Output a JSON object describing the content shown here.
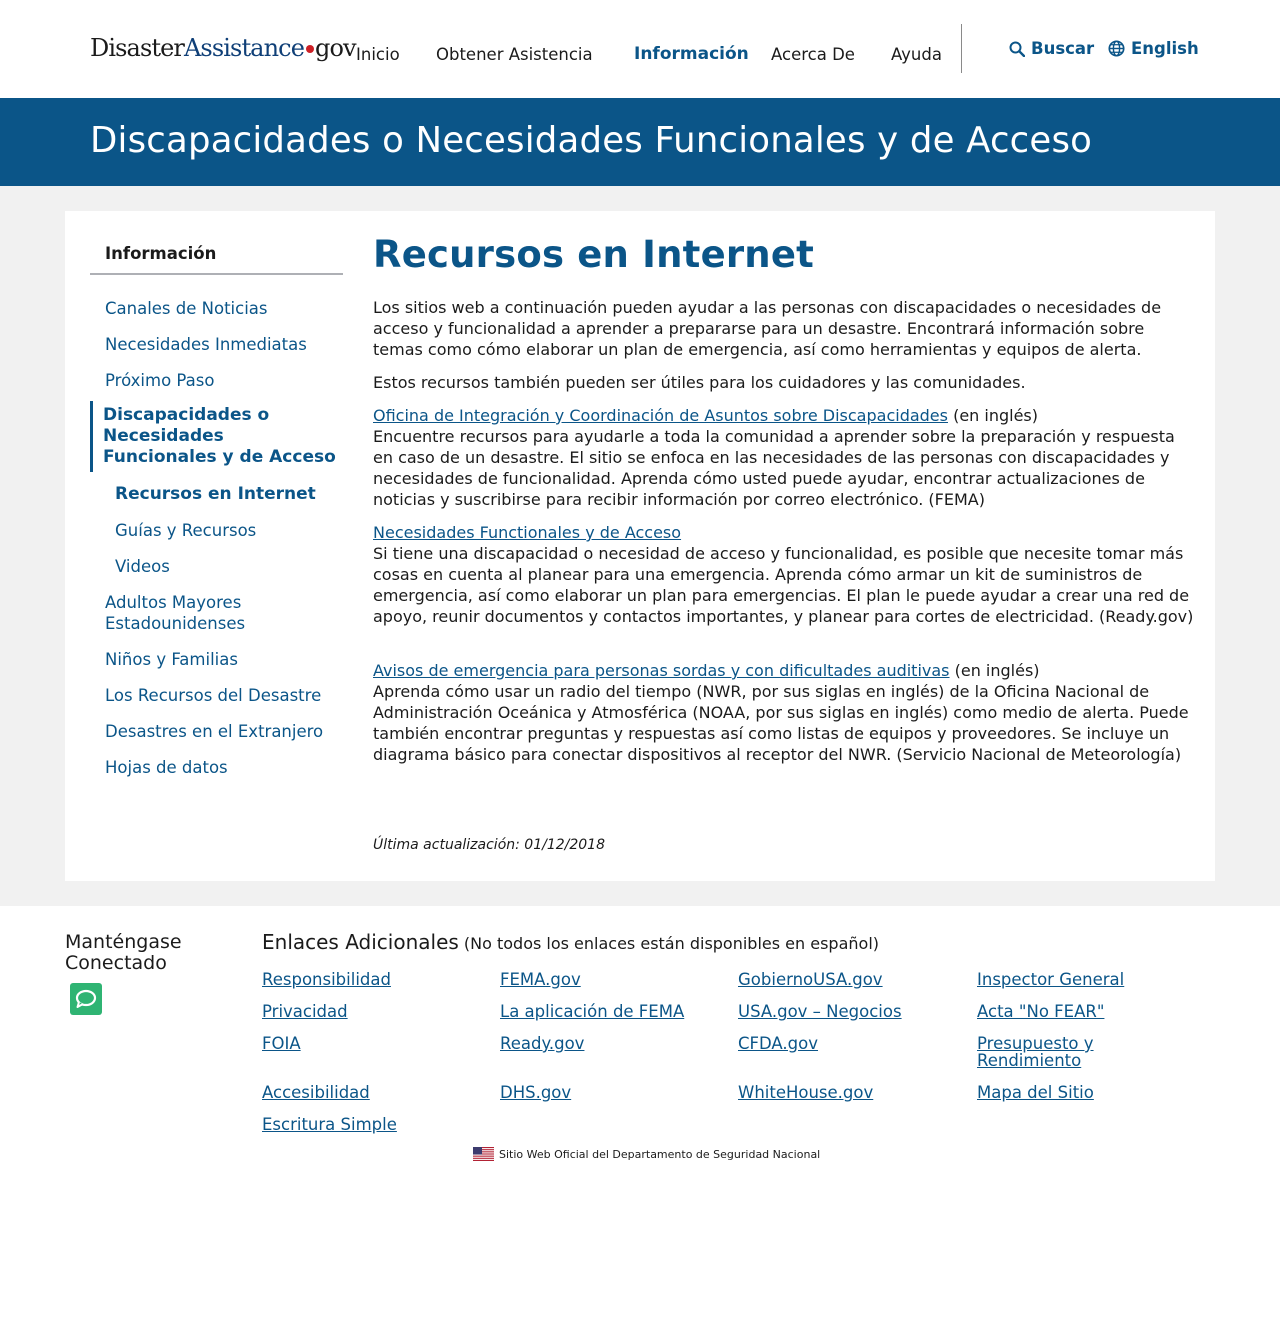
{
  "logo": {
    "part1": "Disaster",
    "part2": "Assistance",
    "part3": "gov"
  },
  "nav": {
    "items": [
      {
        "label": "Inicio"
      },
      {
        "label": "Obtener Asistencia"
      },
      {
        "label": "Información"
      },
      {
        "label": "Acerca De"
      },
      {
        "label": "Ayuda"
      }
    ],
    "search_label": "Buscar",
    "language_label": "English"
  },
  "hero": {
    "title": "Discapacidades o Necesidades Funcionales y de Acceso"
  },
  "sidebar": {
    "heading": "Información",
    "items": [
      {
        "label": "Canales de Noticias"
      },
      {
        "label": "Necesidades Inmediatas"
      },
      {
        "label": "Próximo Paso"
      },
      {
        "label": "Discapacidades o Necesidades Funcionales y de Acceso"
      },
      {
        "label": "Recursos en Internet"
      },
      {
        "label": "Guías y Recursos"
      },
      {
        "label": "Videos"
      },
      {
        "label": "Adultos Mayores Estadounidenses"
      },
      {
        "label": "Niños y Familias"
      },
      {
        "label": "Los Recursos del Desastre"
      },
      {
        "label": "Desastres en el Extranjero"
      },
      {
        "label": "Hojas de datos"
      }
    ]
  },
  "main": {
    "title": "Recursos en Internet",
    "intro1": "Los sitios web a continuación pueden ayudar a las personas con discapacidades o necesidades de acceso y funcionalidad a aprender a prepararse para un desastre. Encontrará información sobre temas como cómo elaborar un plan de emergencia, así como herramientas y equipos de alerta.",
    "intro2": "Estos recursos también pueden ser útiles para los cuidadores y las comunidades.",
    "resources": [
      {
        "link": "Oficina de Integración y Coordinación de Asuntos sobre Discapacidades",
        "suffix": " (en inglés)",
        "text": "Encuentre recursos para ayudarle a toda la comunidad a aprender sobre la preparación y respuesta en caso de un desastre. El sitio se enfoca en las necesidades de las personas con discapacidades y necesidades de funcionalidad. Aprenda cómo usted puede ayudar, encontrar actualizaciones de noticias y suscribirse para recibir información por correo electrónico. (FEMA)"
      },
      {
        "link": "Necesidades Functionales y de Acceso",
        "suffix": "",
        "text": "Si tiene una discapacidad o necesidad de acceso y funcionalidad, es posible que necesite tomar más cosas en cuenta al planear para una emergencia. Aprenda cómo armar un kit de suministros de emergencia, así como elaborar un plan para emergencias. El plan le puede ayudar a crear una red de apoyo, reunir documentos y contactos importantes, y planear para cortes de electricidad. (Ready.gov)"
      },
      {
        "link": "Avisos de emergencia para personas sordas y con dificultades auditivas",
        "suffix": " (en inglés)",
        "text": "Aprenda cómo usar un radio del tiempo (NWR, por sus siglas en inglés) de la Oficina Nacional de Administración Oceánica y Atmosférica (NOAA, por sus siglas en inglés) como medio de alerta. Puede también encontrar preguntas y respuestas así como listas de equipos y proveedores. Se incluye un diagrama básico para conectar dispositivos al receptor del NWR. (Servicio Nacional de Meteorología)"
      }
    ],
    "updated": "Última actualización: 01/12/2018"
  },
  "footer": {
    "stay_connected": "Manténgase Conectado",
    "links_heading": "Enlaces Adicionales",
    "links_note": " (No todos los enlaces están disponibles en español)",
    "links": [
      "Responsibilidad",
      "FEMA.gov",
      "GobiernoUSA.gov",
      "Inspector General",
      "Privacidad",
      "La aplicación de FEMA",
      "USA.gov – Negocios",
      "Acta \"No FEAR\"",
      "FOIA",
      "Ready.gov",
      "CFDA.gov",
      "Presupuesto y Rendimiento",
      "Accesibilidad",
      "DHS.gov",
      "WhiteHouse.gov",
      "Mapa del Sitio",
      "Escritura Simple"
    ],
    "dhs_text": "Sitio Web Oficial del Departamento de Seguridad Nacional"
  },
  "colors": {
    "primary": "#0b5588",
    "logo_dot": "#cd2026",
    "chat": "#2fb473",
    "page_gray": "#f1f1f1"
  },
  "icons": {
    "search": "search-icon",
    "language": "globe-icon",
    "chat": "chat-icon",
    "flag": "us-flag-icon"
  }
}
